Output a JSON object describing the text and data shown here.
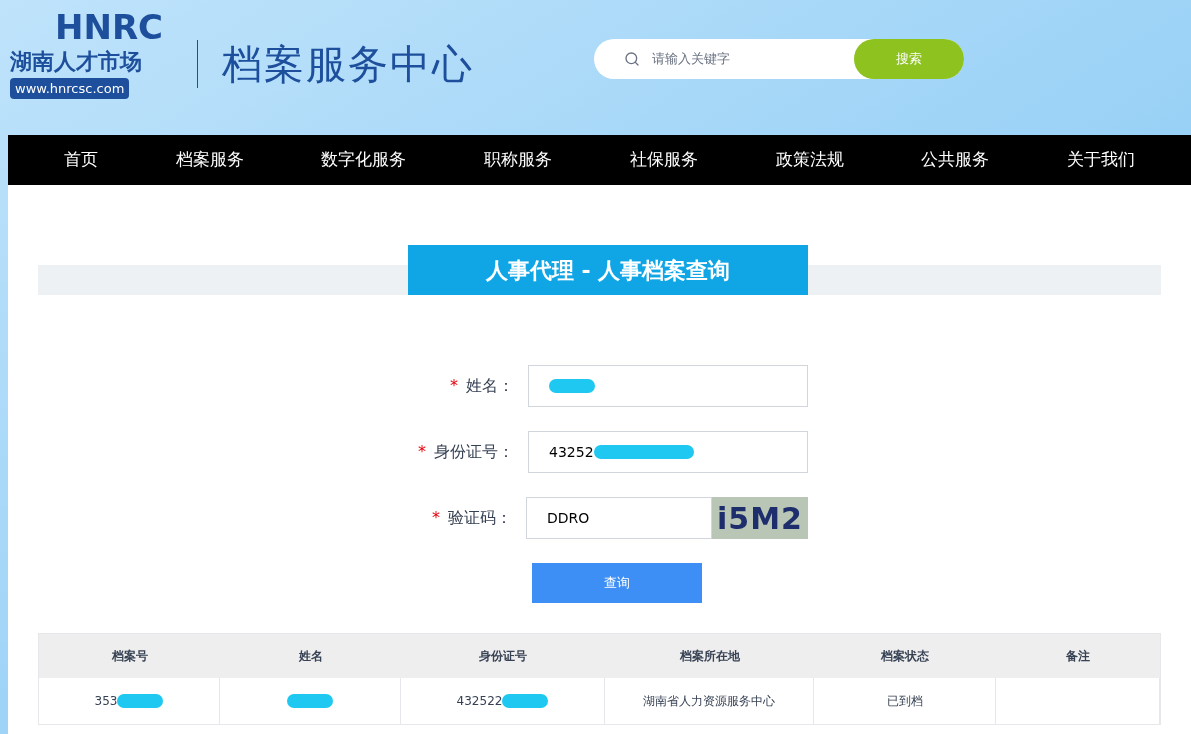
{
  "header": {
    "logo_mark": "HNRC",
    "logo_name": "湖南人才市场",
    "logo_url": "www.hnrcsc.com",
    "site_title": "档案服务中心",
    "search": {
      "placeholder": "请输入关键字",
      "button": "搜索"
    }
  },
  "nav": [
    "首页",
    "档案服务",
    "数字化服务",
    "职称服务",
    "社保服务",
    "政策法规",
    "公共服务",
    "关于我们"
  ],
  "section_title": "人事代理 - 人事档案查询",
  "form": {
    "fields": [
      {
        "kind": "text",
        "required_mark": "*",
        "label": "姓名：",
        "redacted": true
      },
      {
        "kind": "text",
        "required_mark": "*",
        "label": "身份证号：",
        "value": "43252",
        "redacted": true
      },
      {
        "kind": "captcha",
        "required_mark": "*",
        "label": "验证码：",
        "value": "DDRO",
        "captcha": "i5M2"
      }
    ],
    "submit": "查询"
  },
  "table": {
    "columns": [
      "档案号",
      "姓名",
      "身份证号",
      "档案所在地",
      "档案状态",
      "备注"
    ],
    "rows": [
      [
        {
          "text": "353",
          "redacted": true
        },
        {
          "redacted": true
        },
        {
          "text": "432522",
          "redacted": true
        },
        {
          "text": "湖南省人力资源服务中心",
          "redacted": false
        },
        {
          "text": "已到档",
          "redacted": false
        },
        {
          "redacted": false
        }
      ]
    ]
  }
}
